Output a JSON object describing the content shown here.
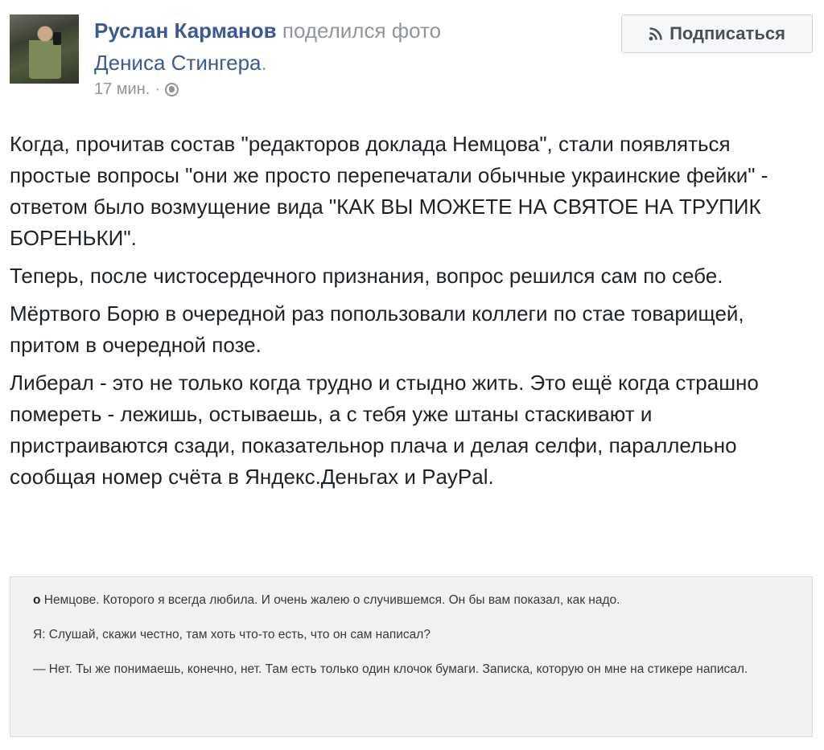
{
  "post": {
    "author": "Руслан Карманов",
    "action": "поделился фото",
    "source_line": "Дениса Стингера.",
    "source_name": "Дениса Стингера",
    "time": "17 мин.",
    "separator": "·",
    "privacy_icon": "globe-icon",
    "subscribe_label": "Подписаться",
    "subscribe_icon": "rss-icon"
  },
  "body": {
    "paragraphs": [
      "Когда, прочитав состав \"редакторов доклада Немцова\", стали появляться простые вопросы \"они же просто перепечатали обычные украинские фейки\" - ответом было возмущение вида \"КАК ВЫ МОЖЕТЕ НА СВЯТОЕ НА ТРУПИК БОРЕНЬКИ\".",
      "Теперь, после чистосердечного признания, вопрос решился сам по себе.",
      "Мёртвого Борю в очередной раз попользовали коллеги по стае товарищей, притом в очередной позе.",
      "Либерал - это не только когда трудно и стыдно жить. Это ещё когда страшно помереть - лежишь, остываешь, а с тебя уже штаны стаскивают и пристраиваются сзади, показательнор плача и делая селфи, параллельно сообщая номер счёта в Яндекс.Деньгах и PayPal."
    ]
  },
  "quote": {
    "mark": "о",
    "line1": "Немцове. Которого я всегда любила. И очень жалею о случившемся. Он бы вам показал, как надо.",
    "line2": "Я: Слушай, скажи честно, там хоть что-то есть, что он сам написал?",
    "line3": "— Нет. Ты же понимаешь, конечно, нет. Там есть только один клочок бумаги. Записка, которую он мне на стикере написал."
  },
  "colors": {
    "link": "#3b5998",
    "meta": "#90949c",
    "text": "#1d2129",
    "quote_bg": "#f1f1f1"
  }
}
